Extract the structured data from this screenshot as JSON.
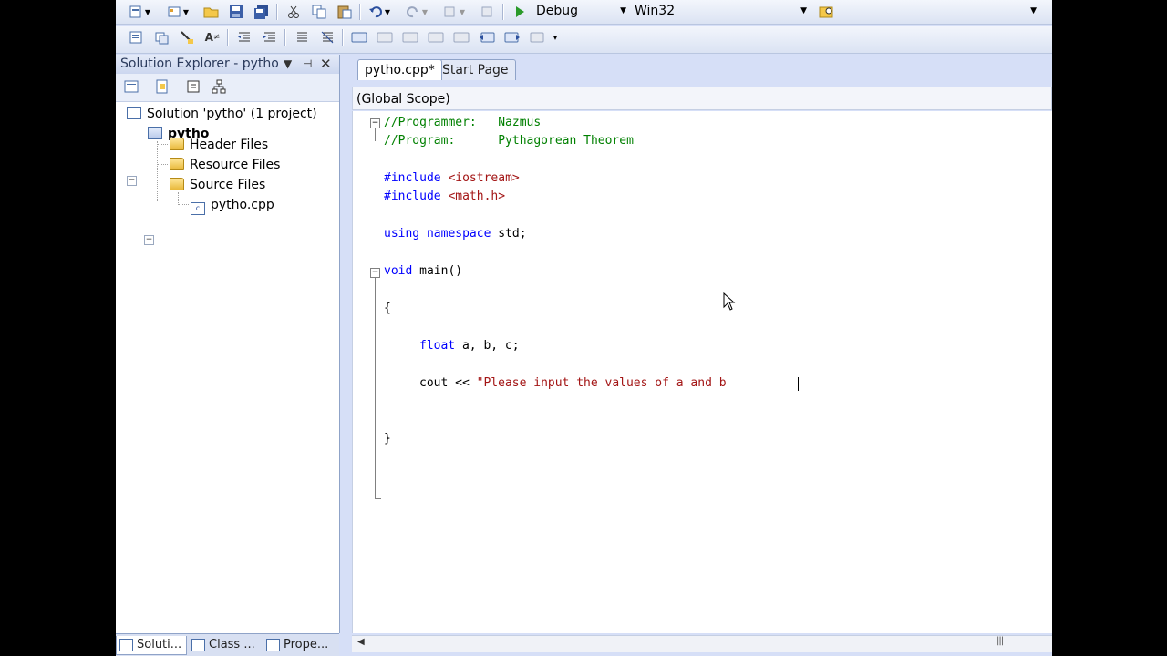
{
  "toolbar": {
    "configuration": "Debug",
    "platform": "Win32"
  },
  "solution_explorer": {
    "title": "Solution Explorer - pytho",
    "solution": "Solution 'pytho' (1 project)",
    "project": "pytho",
    "folders": [
      "Header Files",
      "Resource Files",
      "Source Files"
    ],
    "file": "pytho.cpp"
  },
  "bottom_tabs": [
    "Soluti...",
    "Class ...",
    "Prope..."
  ],
  "editor": {
    "tabs": [
      "pytho.cpp*",
      "Start Page"
    ],
    "scope": "(Global Scope)",
    "lines": {
      "l1_comment": "//Programmer:   Nazmus",
      "l2_comment": "//Program:      Pythagorean Theorem",
      "l3_kw": "#include ",
      "l3_str": "<iostream>",
      "l4_kw": "#include ",
      "l4_str": "<math.h>",
      "l5_kw1": "using",
      "l5_sp": " ",
      "l5_kw2": "namespace",
      "l5_rest": " std;",
      "l6_kw": "void",
      "l6_rest": " main()",
      "l7": "{",
      "l8_kw": "float",
      "l8_rest": " a, b, c;",
      "l9_pl": "cout << ",
      "l9_str": "\"Please input the values of a and b",
      "l10": "}"
    }
  }
}
